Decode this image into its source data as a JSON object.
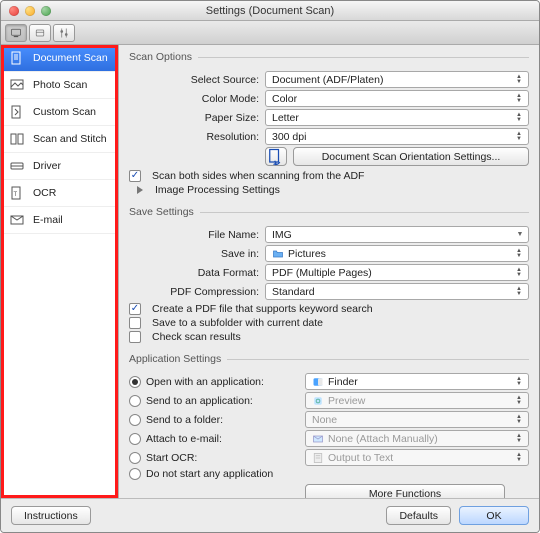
{
  "window": {
    "title": "Settings (Document Scan)"
  },
  "sidebar": {
    "items": [
      {
        "label": "Document Scan",
        "icon": "document-scan-icon",
        "selected": true
      },
      {
        "label": "Photo Scan",
        "icon": "photo-scan-icon"
      },
      {
        "label": "Custom Scan",
        "icon": "custom-scan-icon"
      },
      {
        "label": "Scan and Stitch",
        "icon": "stitch-icon"
      },
      {
        "label": "Driver",
        "icon": "driver-icon"
      },
      {
        "label": "OCR",
        "icon": "ocr-icon"
      },
      {
        "label": "E-mail",
        "icon": "email-icon"
      }
    ]
  },
  "sections": {
    "scan_options": {
      "legend": "Scan Options",
      "select_source": {
        "label": "Select Source:",
        "value": "Document (ADF/Platen)"
      },
      "color_mode": {
        "label": "Color Mode:",
        "value": "Color"
      },
      "paper_size": {
        "label": "Paper Size:",
        "value": "Letter"
      },
      "resolution": {
        "label": "Resolution:",
        "value": "300 dpi"
      },
      "orientation_btn": "Document Scan Orientation Settings...",
      "scan_both_sides": {
        "label": "Scan both sides when scanning from the ADF",
        "checked": true
      },
      "image_processing": {
        "label": "Image Processing Settings"
      }
    },
    "save_settings": {
      "legend": "Save Settings",
      "file_name": {
        "label": "File Name:",
        "value": "IMG"
      },
      "save_in": {
        "label": "Save in:",
        "value": "Pictures",
        "icon": "folder-icon"
      },
      "data_format": {
        "label": "Data Format:",
        "value": "PDF (Multiple Pages)"
      },
      "pdf_comp": {
        "label": "PDF Compression:",
        "value": "Standard"
      },
      "pdf_keyword": {
        "label": "Create a PDF file that supports keyword search",
        "checked": true
      },
      "save_subfolder": {
        "label": "Save to a subfolder with current date",
        "checked": false
      },
      "check_results": {
        "label": "Check scan results",
        "checked": false
      }
    },
    "app_settings": {
      "legend": "Application Settings",
      "options": [
        {
          "key": "open_app",
          "label": "Open with an application:",
          "checked": true,
          "popup": {
            "value": "Finder",
            "icon": "finder-icon",
            "enabled": true
          }
        },
        {
          "key": "send_app",
          "label": "Send to an application:",
          "checked": false,
          "popup": {
            "value": "Preview",
            "icon": "preview-icon",
            "enabled": false
          }
        },
        {
          "key": "send_folder",
          "label": "Send to a folder:",
          "checked": false,
          "popup": {
            "value": "None",
            "icon": null,
            "enabled": false
          }
        },
        {
          "key": "attach",
          "label": "Attach to e-mail:",
          "checked": false,
          "popup": {
            "value": "None (Attach Manually)",
            "icon": "mail-icon",
            "enabled": false
          }
        },
        {
          "key": "start_ocr",
          "label": "Start OCR:",
          "checked": false,
          "popup": {
            "value": "Output to Text",
            "icon": "text-icon",
            "enabled": false
          }
        },
        {
          "key": "none",
          "label": "Do not start any application",
          "checked": false,
          "popup": null
        }
      ],
      "more_functions": "More Functions"
    }
  },
  "footer": {
    "instructions": "Instructions",
    "defaults": "Defaults",
    "ok": "OK"
  }
}
